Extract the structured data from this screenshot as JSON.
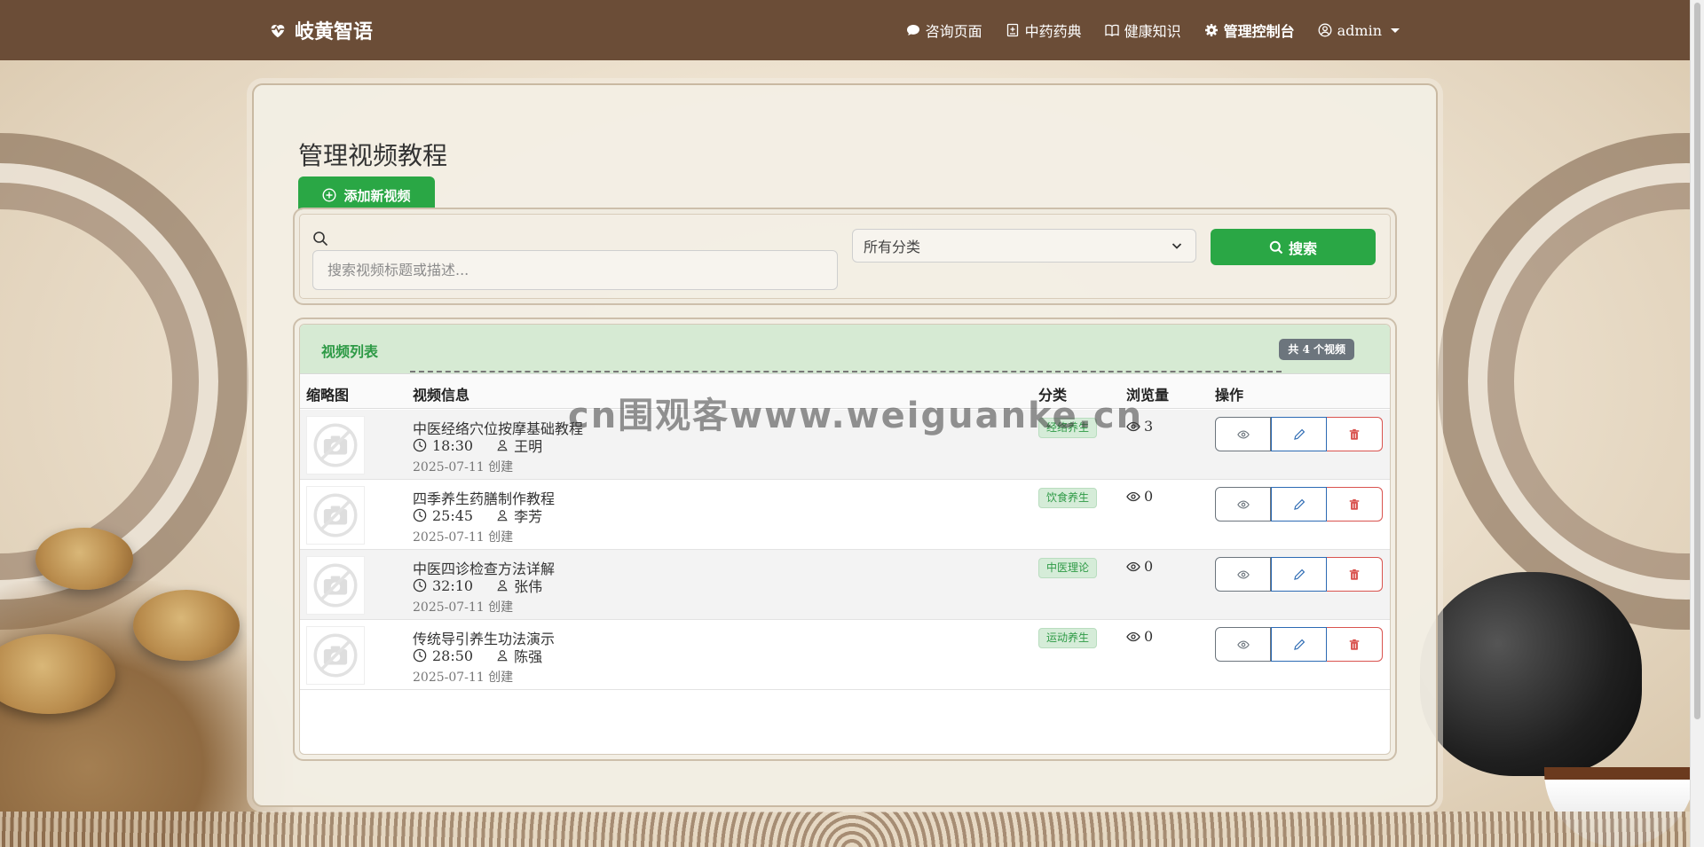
{
  "brand": {
    "name": "岐黄智语",
    "icon": "heart-pulse-icon"
  },
  "nav": {
    "items": [
      {
        "label": "咨询页面",
        "icon": "chat-icon"
      },
      {
        "label": "中药药典",
        "icon": "book-medical-icon"
      },
      {
        "label": "健康知识",
        "icon": "open-book-icon"
      },
      {
        "label": "管理控制台",
        "icon": "gear-icon"
      }
    ],
    "user": {
      "label": "admin",
      "icon": "user-circle-icon"
    }
  },
  "page": {
    "title": "管理视频教程",
    "add_button": "添加新视频"
  },
  "search": {
    "placeholder": "搜索视频标题或描述...",
    "value": "",
    "category_selected": "所有分类",
    "button": "搜索"
  },
  "list": {
    "title": "视频列表",
    "count_badge": "共 4 个视频",
    "columns": [
      "缩略图",
      "视频信息",
      "分类",
      "浏览量",
      "操作"
    ],
    "rows": [
      {
        "title": "中医经络穴位按摩基础教程",
        "duration": "18:30",
        "author": "王明",
        "created": "2025-07-11 创建",
        "category": "经络养生",
        "views": "3"
      },
      {
        "title": "四季养生药膳制作教程",
        "duration": "25:45",
        "author": "李芳",
        "created": "2025-07-11 创建",
        "category": "饮食养生",
        "views": "0"
      },
      {
        "title": "中医四诊检查方法详解",
        "duration": "32:10",
        "author": "张伟",
        "created": "2025-07-11 创建",
        "category": "中医理论",
        "views": "0"
      },
      {
        "title": "传统导引养生功法演示",
        "duration": "28:50",
        "author": "陈强",
        "created": "2025-07-11 创建",
        "category": "运动养生",
        "views": "0"
      }
    ]
  },
  "watermark": "cn围观客www.weiguanke.cn",
  "colors": {
    "navbar": "#6b4d37",
    "primary_green": "#2aa745",
    "list_header": "#d6ead3",
    "badge_gray": "#6c757d",
    "edit_blue": "#2c6ab3",
    "delete_red": "#d9534f"
  }
}
